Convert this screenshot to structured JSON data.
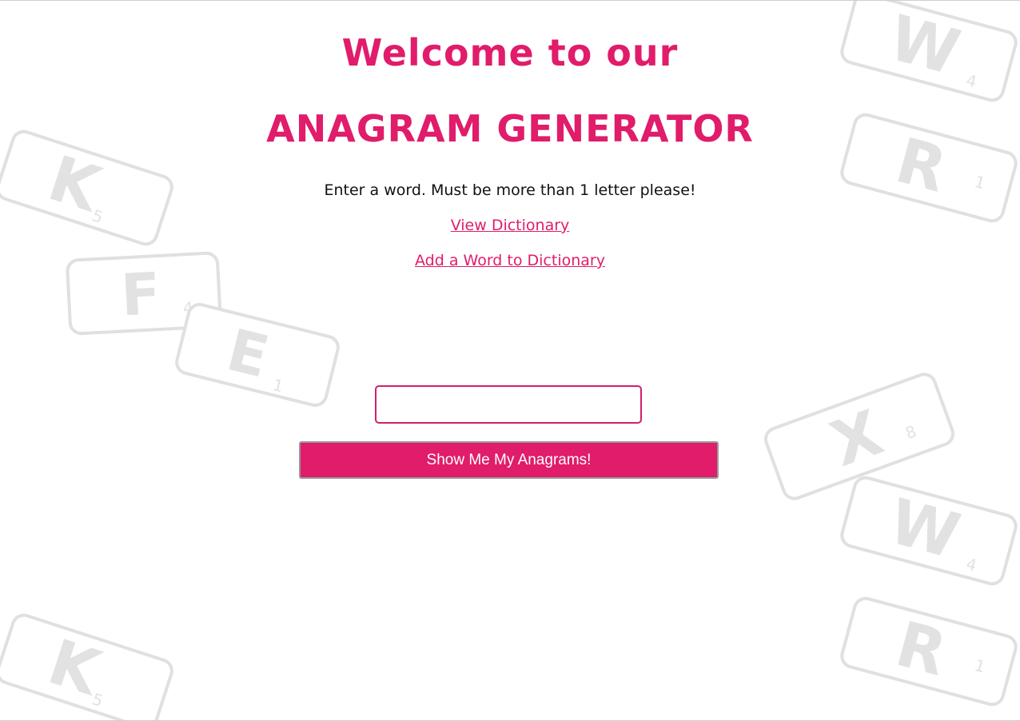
{
  "header": {
    "welcome_line": "Welcome to our",
    "title": "ANAGRAM GENERATOR"
  },
  "instructions": "Enter a word. Must be more than 1 letter please!",
  "links": {
    "view_dictionary": "View Dictionary",
    "add_word": "Add a Word to Dictionary"
  },
  "form": {
    "word_input_value": "",
    "submit_label": "Show Me My Anagrams!"
  },
  "background_tiles": [
    {
      "letter": "W",
      "points": "4"
    },
    {
      "letter": "R",
      "points": "1"
    },
    {
      "letter": "K",
      "points": "5"
    },
    {
      "letter": "F",
      "points": "4"
    },
    {
      "letter": "E",
      "points": "1"
    },
    {
      "letter": "X",
      "points": "8"
    },
    {
      "letter": "W",
      "points": "4"
    },
    {
      "letter": "R",
      "points": "1"
    },
    {
      "letter": "K",
      "points": "5"
    }
  ],
  "colors": {
    "accent": "#e01c6b",
    "tile_gray": "#e2e2e2",
    "text": "#111111",
    "background": "#ffffff"
  }
}
